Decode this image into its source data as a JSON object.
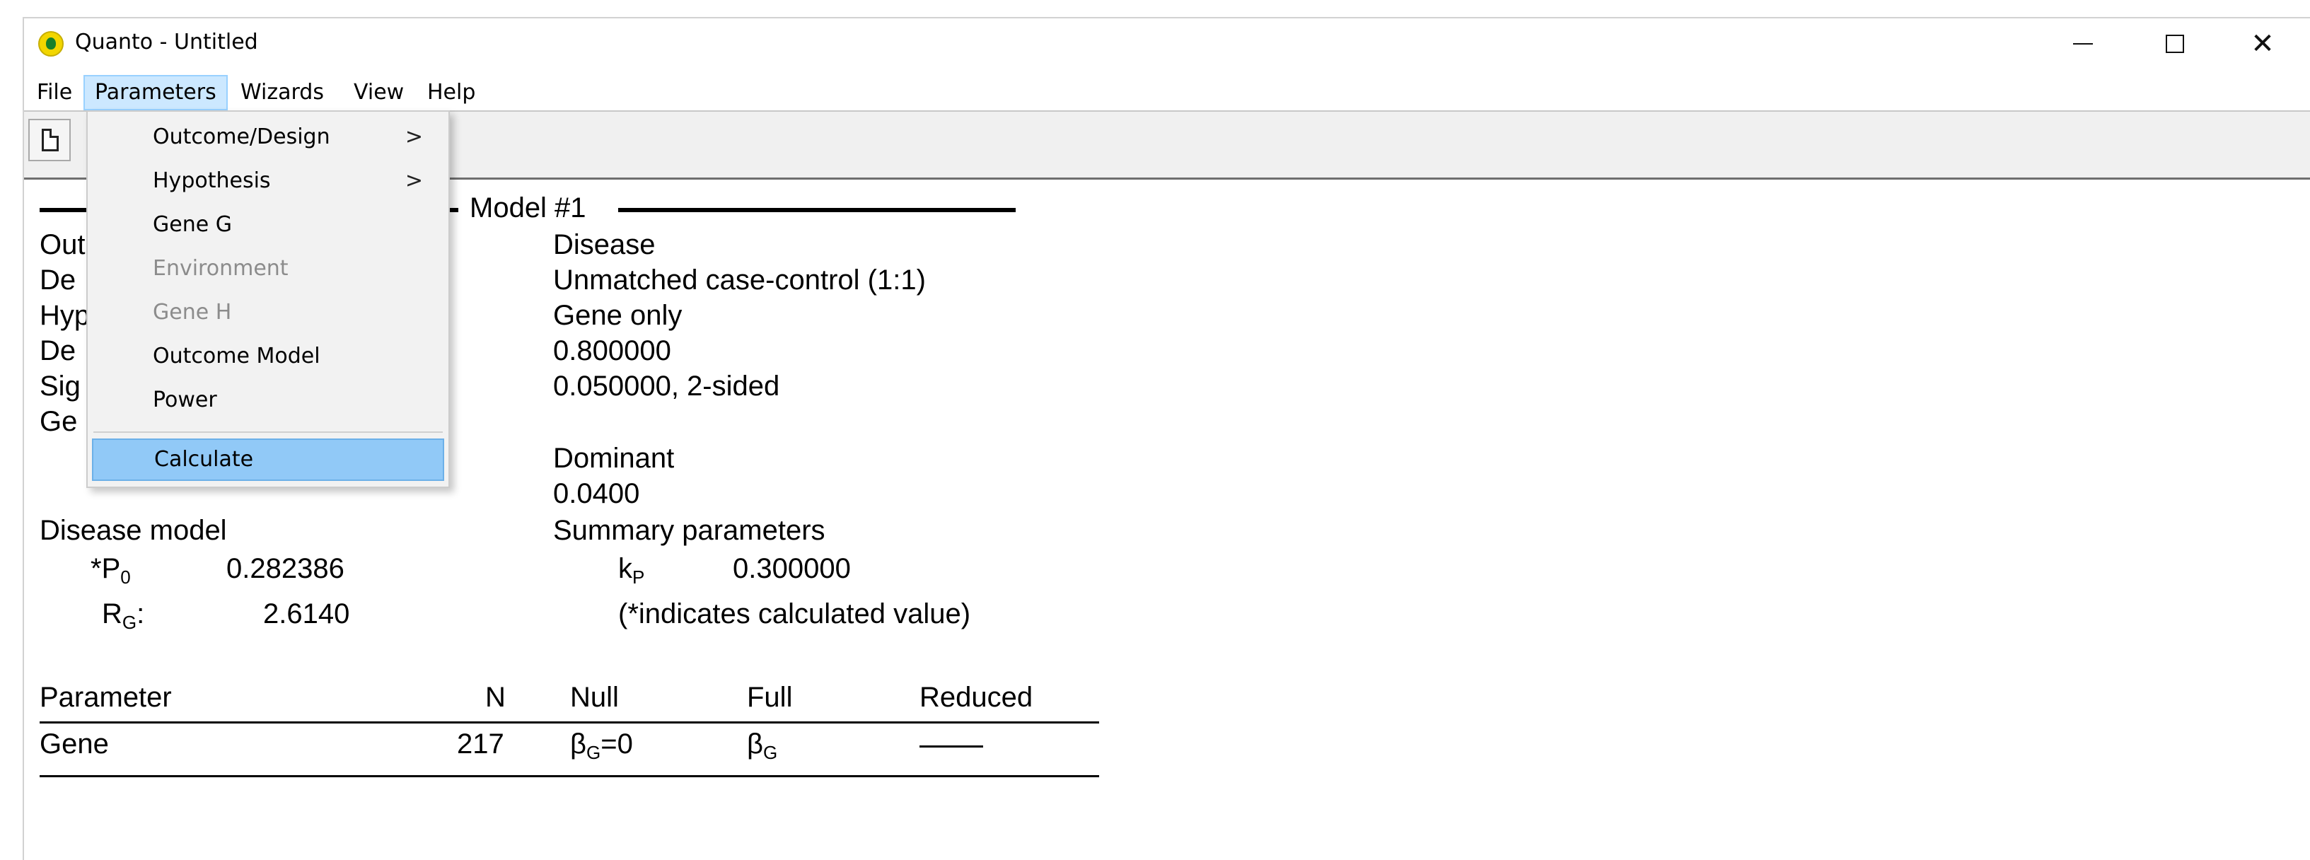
{
  "window": {
    "title": "Quanto - Untitled"
  },
  "menubar": {
    "items": [
      {
        "label": "File"
      },
      {
        "label": "Parameters"
      },
      {
        "label": "Wizards"
      },
      {
        "label": "View"
      },
      {
        "label": "Help"
      }
    ]
  },
  "parameters_menu": {
    "items": [
      {
        "label": "Outcome/Design",
        "submenu": ">",
        "enabled": true
      },
      {
        "label": "Hypothesis",
        "submenu": ">",
        "enabled": true
      },
      {
        "label": "Gene G",
        "enabled": true
      },
      {
        "label": "Environment",
        "enabled": false
      },
      {
        "label": "Gene H",
        "enabled": false
      },
      {
        "label": "Outcome Model",
        "enabled": true
      },
      {
        "label": "Power",
        "enabled": true
      },
      {
        "label": "Calculate",
        "enabled": true,
        "selected": true
      }
    ]
  },
  "report": {
    "model_title": "Model #1",
    "label_fragments": [
      "Out",
      "De",
      "Hyp",
      "De",
      "Sig",
      "Ge"
    ],
    "values": {
      "outcome": "Disease",
      "design": "Unmatched case-control (1:1)",
      "hypothesis": "Gene only",
      "desired_power": "0.800000",
      "significance": "0.050000, 2-sided",
      "gene_mode": "Dominant",
      "allele_frequency": "0.0400",
      "summary": "Summary parameters"
    },
    "disease_model": {
      "label": "Disease model",
      "p0_label": "*P",
      "p0_sub": "0",
      "p0_value": "0.282386",
      "rg_label": "R",
      "rg_sub": "G",
      "rg_colon": ":",
      "rg_value": "2.6140",
      "kp_label": "k",
      "kp_sub": "P",
      "kp_value": "0.300000",
      "note": "(*indicates calculated value)"
    },
    "results": {
      "headers": [
        "Parameter",
        "N",
        "Null",
        "Full",
        "Reduced"
      ],
      "row": {
        "parameter": "Gene",
        "n": "217",
        "null_symbol": "β",
        "null_sub": "G",
        "null_suffix": "=0",
        "full_symbol": "β",
        "full_sub": "G"
      }
    }
  },
  "colors": {
    "menu_highlight": "#cce8ff",
    "dropdown_selected": "#91c9f7",
    "disabled_text": "#8c8c8c",
    "app_icon": "#f2d600"
  },
  "icons": [
    "app-icon",
    "minimize-icon",
    "maximize-icon",
    "close-icon",
    "new-document-icon",
    "chevron-right-icon"
  ]
}
